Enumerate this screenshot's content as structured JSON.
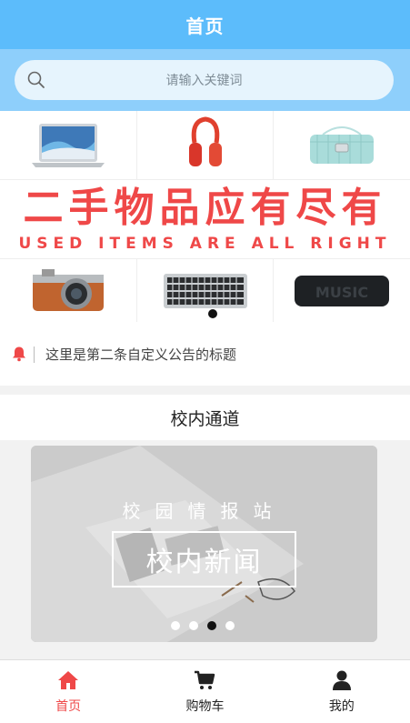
{
  "header": {
    "title": "首页"
  },
  "search": {
    "placeholder": "请输入关键词",
    "icon": "search-icon"
  },
  "banner": {
    "slogan_cn": "二手物品应有尽有",
    "slogan_en": "USED ITEMS ARE ALL RIGHT",
    "products_top": [
      "laptop",
      "headphones",
      "handbag"
    ],
    "products_bottom": [
      "camera",
      "keyboard",
      "speaker"
    ],
    "speaker_text": "MUSIC",
    "accent_color": "#ef4848"
  },
  "notice": {
    "icon": "bell-icon",
    "text": "这里是第二条自定义公告的标题"
  },
  "section": {
    "title": "校内通道"
  },
  "carousel": {
    "subtitle": "校园情报站",
    "headline": "校内新闻",
    "dots": 4,
    "active_dot": 3
  },
  "tabbar": {
    "items": [
      {
        "label": "首页",
        "icon": "home-icon",
        "active": true
      },
      {
        "label": "购物车",
        "icon": "cart-icon",
        "active": false
      },
      {
        "label": "我的",
        "icon": "user-icon",
        "active": false
      }
    ]
  },
  "colors": {
    "header": "#5cbcfb",
    "search_bg": "#8ecffb",
    "active_tab": "#ef4848"
  }
}
